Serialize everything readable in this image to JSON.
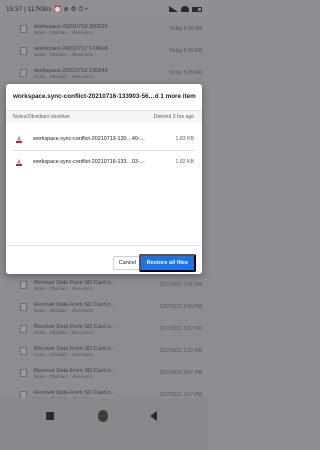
{
  "status_bar": {
    "left": "15:37 | 117KB/s ⏰ ⊕ ⚙ ⏱ •"
  },
  "background_rows": [
    {
      "name": "workspace-20210716 200526",
      "path": "Notes · Obsidian · .shversions",
      "time": "Today 5:20 AM"
    },
    {
      "name": "workspace-20210717 174606",
      "path": "Notes · Obsidian · .shversions",
      "time": "Today 5:20 AM"
    },
    {
      "name": "workspace-20210716 130649",
      "path": "Notes · Obsidian · .shversions",
      "time": "Today 5:05 AM"
    },
    {
      "name": "Recover Data From SD Card o…",
      "path": "Notes · Obsidian · .shversions",
      "time": "23/7/2021 2:41 PM"
    },
    {
      "name": "Recover Data From SD Card o…",
      "path": "Notes · Obsidian · .shversions",
      "time": "23/7/2021 2:36 PM"
    },
    {
      "name": "Recover Data From SD Card o…",
      "path": "Notes · Obsidian · .shversions",
      "time": "23/7/2021 2:27 PM"
    },
    {
      "name": "Recover Data From SD Card o…",
      "path": "Notes · Obsidian · .shversions",
      "time": "23/7/2021 2:22 PM"
    },
    {
      "name": "Recover Data From SD Card o…",
      "path": "Notes · Obsidian · .shversions",
      "time": "23/7/2021 2:07 PM"
    },
    {
      "name": "Recover Data From SD Card o…",
      "path": "Notes · Obsidian · .shversions",
      "time": "23/7/2021 2:07 PM"
    }
  ],
  "dialog": {
    "title": "workspace.sync-conflict-20210716-133903-56…d 1 more item",
    "path_header": "Notes/Obsidian/.obsidian",
    "deleted_header": "Deleted 3 hrs ago",
    "files": [
      {
        "name": "workspace.sync-conflict-20210712-130…40-…",
        "size": "1.83 KB"
      },
      {
        "name": "workspace.sync-conflict-20210716-133…03-…",
        "size": "1.82 KB"
      }
    ],
    "cancel_label": "Cancel",
    "restore_label": "Restore all files"
  }
}
